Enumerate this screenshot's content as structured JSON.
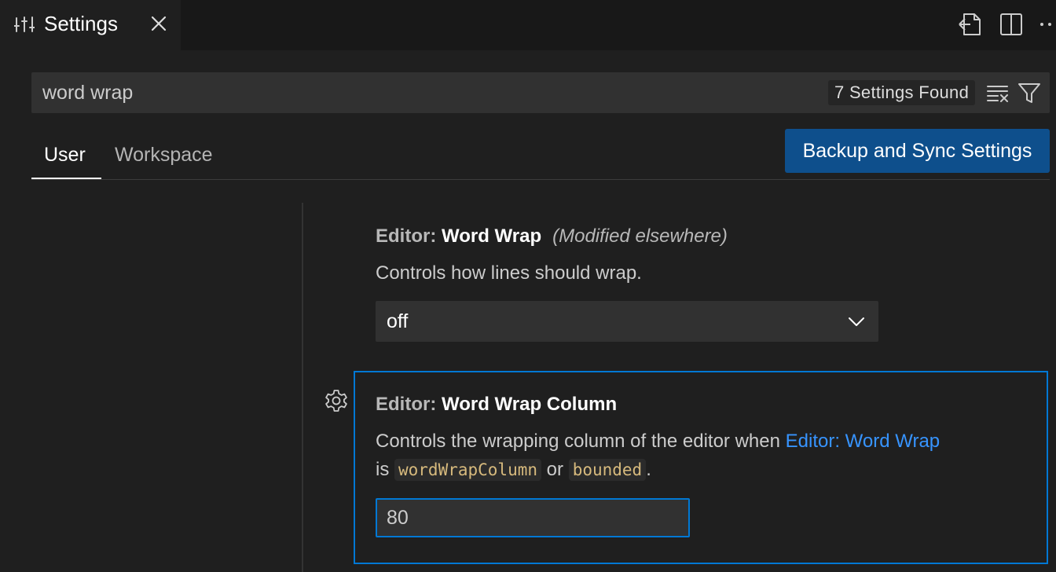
{
  "tab": {
    "title": "Settings",
    "icon": "settings-sliders-icon",
    "close_icon": "close-icon"
  },
  "toolbar": {
    "actions": [
      "open-settings-json-icon",
      "split-editor-icon",
      "more-actions-icon"
    ]
  },
  "search": {
    "value": "word wrap",
    "placeholder": "Search settings",
    "result_count": "7 Settings Found",
    "clear_icon": "clear-filter-icon",
    "filter_icon": "filter-icon"
  },
  "scope_tabs": [
    {
      "label": "User",
      "active": true
    },
    {
      "label": "Workspace",
      "active": false
    }
  ],
  "sync_button": "Backup and Sync Settings",
  "settings": [
    {
      "category": "Editor: ",
      "name": "Word Wrap",
      "modified": "(Modified elsewhere)",
      "description": "Controls how lines should wrap.",
      "value": "off"
    },
    {
      "category": "Editor: ",
      "name": "Word Wrap Column",
      "description_prefix": "Controls the wrapping column of the editor when ",
      "description_link": "Editor: Word Wrap",
      "description_is": "is ",
      "code1": "wordWrapColumn",
      "description_or": " or ",
      "code2": "bounded",
      "description_end": ".",
      "value": "80",
      "gear_icon": "gear-icon"
    }
  ],
  "colors": {
    "accent": "#0078d4",
    "link": "#3794ff",
    "code": "#d7ba7d",
    "sync_button": "#0e4f8c",
    "background": "#1f1f1f"
  }
}
